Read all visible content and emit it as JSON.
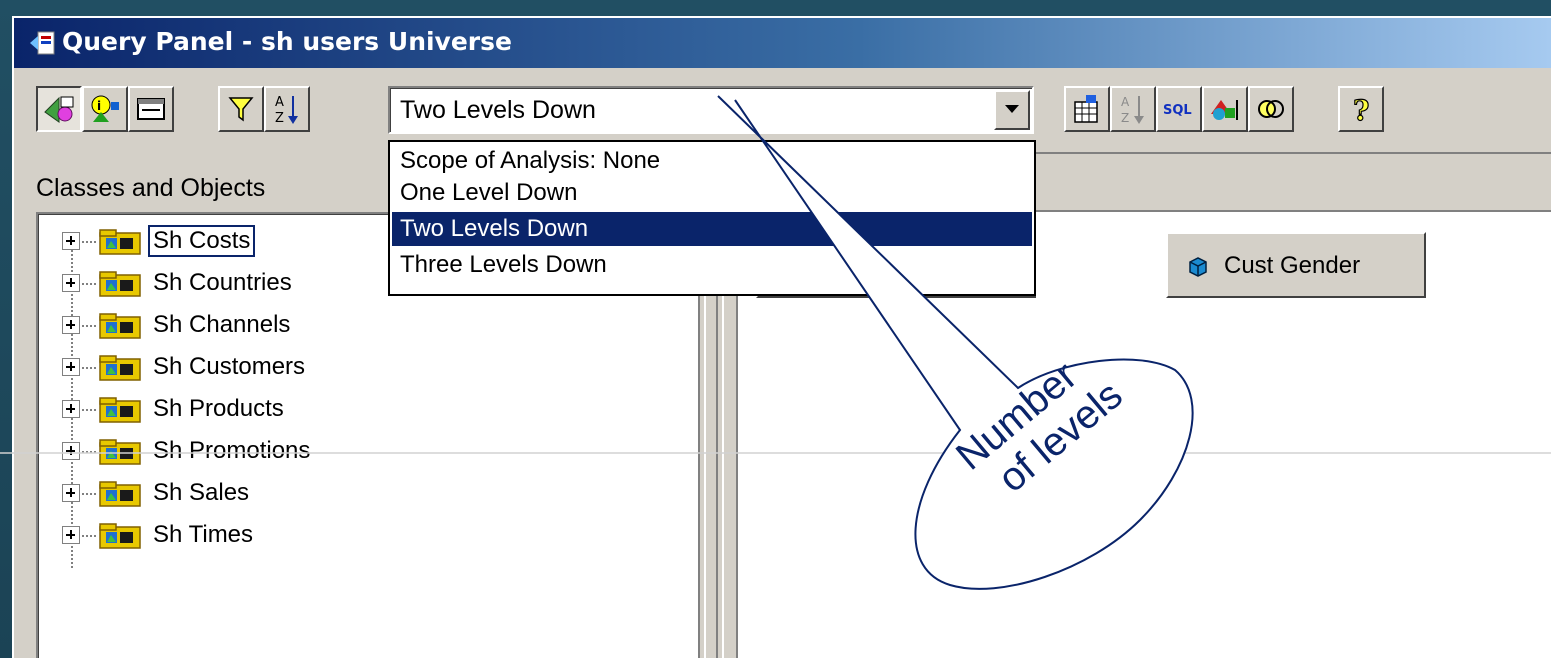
{
  "window": {
    "title": "Query Panel - sh users Universe"
  },
  "toolbar": {
    "left_buttons": [
      {
        "icon": "classes-objects-icon",
        "pressed": true
      },
      {
        "icon": "predefined-conditions-icon",
        "pressed": false
      },
      {
        "icon": "display-window-icon",
        "pressed": false
      },
      {
        "icon": "filter-funnel-icon",
        "pressed": false
      },
      {
        "icon": "sort-az-icon",
        "pressed": false
      }
    ],
    "scope_combo": {
      "value": "Two Levels Down",
      "options": [
        "Scope of Analysis: None",
        "One Level Down",
        "Two Levels Down",
        "Three Levels Down"
      ],
      "selected_index": 2
    },
    "right_buttons": [
      {
        "icon": "run-query-icon"
      },
      {
        "icon": "sort-disabled-icon"
      },
      {
        "icon": "sql-icon",
        "text": "SQL"
      },
      {
        "icon": "options-icon"
      },
      {
        "icon": "combined-queries-icon"
      },
      {
        "icon": "help-icon"
      }
    ]
  },
  "classes_panel": {
    "label": "Classes and Objects",
    "items": [
      {
        "label": "Sh Costs",
        "focused": true
      },
      {
        "label": "Sh Countries",
        "focused": false
      },
      {
        "label": "Sh Channels",
        "focused": false
      },
      {
        "label": "Sh Customers",
        "focused": false
      },
      {
        "label": "Sh Products",
        "focused": false
      },
      {
        "label": "Sh Promotions",
        "focused": false
      },
      {
        "label": "Sh Sales",
        "focused": false
      },
      {
        "label": "Sh Times",
        "focused": false
      }
    ]
  },
  "result_objects": [
    {
      "label": "Cust Gender",
      "icon": "dimension-cube-icon"
    }
  ],
  "callout": {
    "line1": "Number",
    "line2": "of levels",
    "color": "#0a246a"
  }
}
